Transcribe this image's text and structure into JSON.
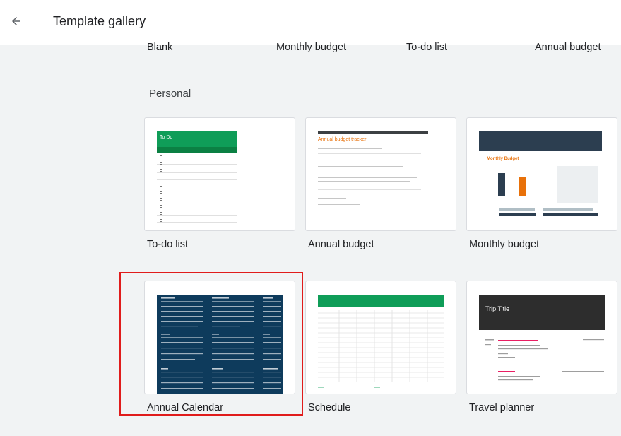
{
  "topbar": {
    "title": "Template gallery"
  },
  "top_row": {
    "labels": [
      "Blank",
      "Monthly budget",
      "To-do list",
      "Annual budget"
    ]
  },
  "personal": {
    "heading": "Personal",
    "templates": [
      {
        "label": "To-do list",
        "preview_title": "To Do"
      },
      {
        "label": "Annual budget",
        "preview_title": "Annual budget tracker"
      },
      {
        "label": "Monthly budget",
        "preview_title": "Monthly Budget"
      },
      {
        "label": "Annual Calendar"
      },
      {
        "label": "Schedule"
      },
      {
        "label": "Travel planner",
        "preview_title": "Trip Title"
      }
    ]
  },
  "colors": {
    "selection_outline": "#e01b1b",
    "todo_green": "#0f9d58",
    "calendar_navy": "#0e3b5c"
  }
}
